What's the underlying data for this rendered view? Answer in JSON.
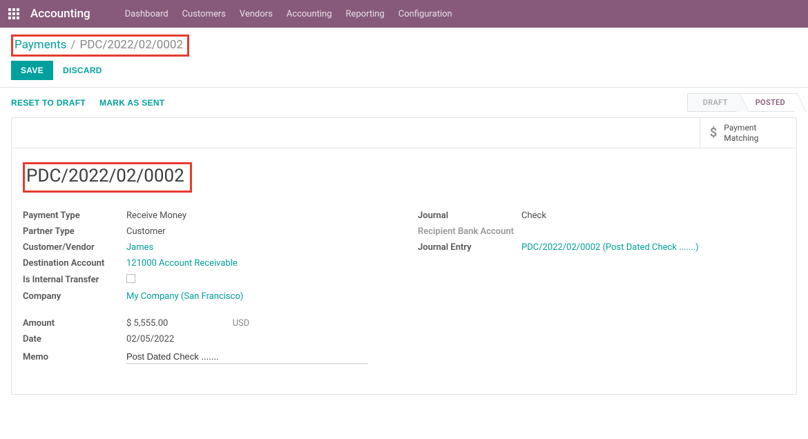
{
  "topnav": {
    "app_title": "Accounting",
    "items": [
      "Dashboard",
      "Customers",
      "Vendors",
      "Accounting",
      "Reporting",
      "Configuration"
    ]
  },
  "breadcrumb": {
    "root": "Payments",
    "current": "PDC/2022/02/0002"
  },
  "actions": {
    "save": "SAVE",
    "discard": "DISCARD"
  },
  "statusbar": {
    "reset": "RESET TO DRAFT",
    "mark_sent": "MARK AS SENT",
    "stages": [
      "DRAFT",
      "POSTED"
    ],
    "active_stage": "POSTED"
  },
  "stat_button": {
    "line1": "Payment",
    "line2": "Matching"
  },
  "record": {
    "title": "PDC/2022/02/0002",
    "left": {
      "payment_type": {
        "label": "Payment Type",
        "value": "Receive Money"
      },
      "partner_type": {
        "label": "Partner Type",
        "value": "Customer"
      },
      "customer_vendor": {
        "label": "Customer/Vendor",
        "value": "James"
      },
      "destination_account": {
        "label": "Destination Account",
        "value": "121000 Account Receivable"
      },
      "is_internal_transfer": {
        "label": "Is Internal Transfer",
        "value": false
      },
      "company": {
        "label": "Company",
        "value": "My Company (San Francisco)"
      },
      "amount": {
        "label": "Amount",
        "value": "$ 5,555.00",
        "currency": "USD"
      },
      "date": {
        "label": "Date",
        "value": "02/05/2022"
      },
      "memo": {
        "label": "Memo",
        "value": "Post Dated Check ......."
      }
    },
    "right": {
      "journal": {
        "label": "Journal",
        "value": "Check"
      },
      "recipient_bank": {
        "label": "Recipient Bank Account",
        "value": ""
      },
      "journal_entry": {
        "label": "Journal Entry",
        "value": "PDC/2022/02/0002 (Post Dated Check .......)"
      }
    }
  }
}
